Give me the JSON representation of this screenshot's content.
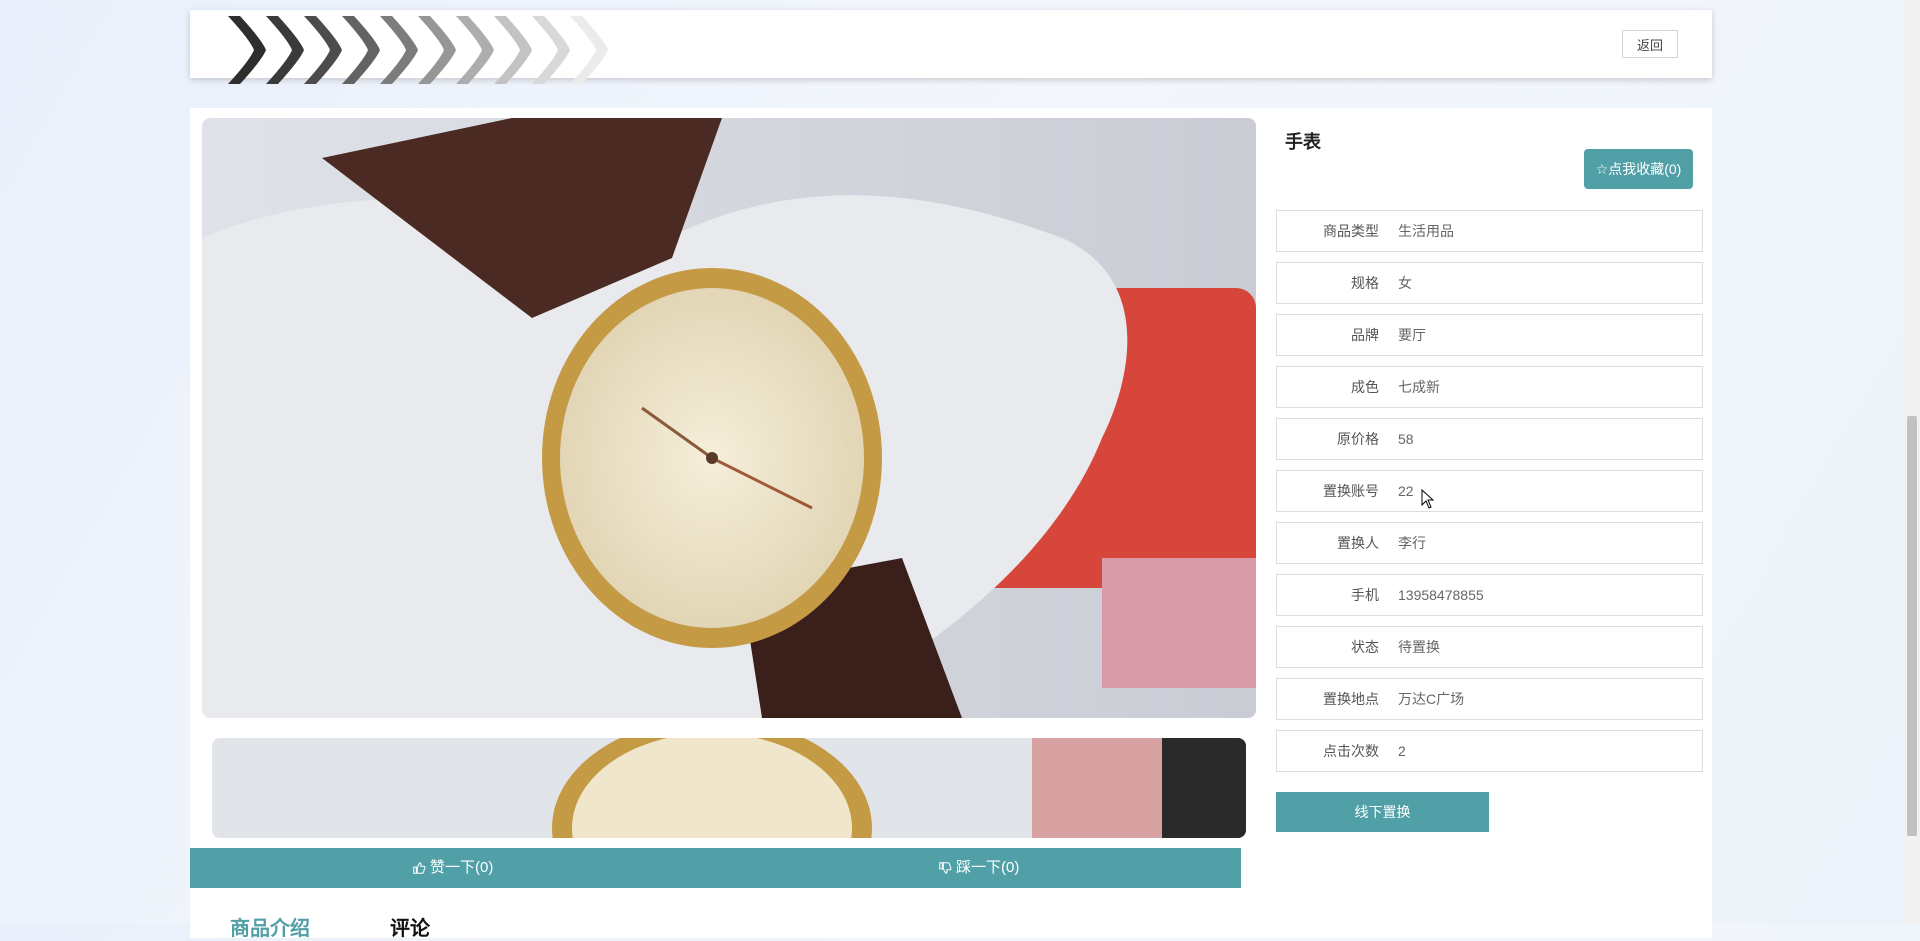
{
  "header": {
    "back_label": "返回"
  },
  "product": {
    "title": "手表",
    "favorite_label": "☆点我收藏(0)",
    "fields": [
      {
        "label": "商品类型",
        "value": "生活用品"
      },
      {
        "label": "规格",
        "value": "女"
      },
      {
        "label": "品牌",
        "value": "要厅"
      },
      {
        "label": "成色",
        "value": "七成新"
      },
      {
        "label": "原价格",
        "value": "58"
      },
      {
        "label": "置换账号",
        "value": "22"
      },
      {
        "label": "置换人",
        "value": "李行"
      },
      {
        "label": "手机",
        "value": "13958478855"
      },
      {
        "label": "状态",
        "value": "待置换"
      },
      {
        "label": "置换地点",
        "value": "万达C广场"
      },
      {
        "label": "点击次数",
        "value": "2"
      }
    ],
    "offline_label": "线下置换"
  },
  "votes": {
    "like_label": "赞一下(0)",
    "dislike_label": "踩一下(0)"
  },
  "tabs": {
    "intro_label": "商品介绍",
    "comments_label": "评论"
  },
  "colors": {
    "accent": "#52a0a7"
  },
  "icons": {
    "like": "thumbs-up-icon",
    "dislike": "thumbs-down-icon",
    "cursor": "mouse-pointer-icon"
  }
}
